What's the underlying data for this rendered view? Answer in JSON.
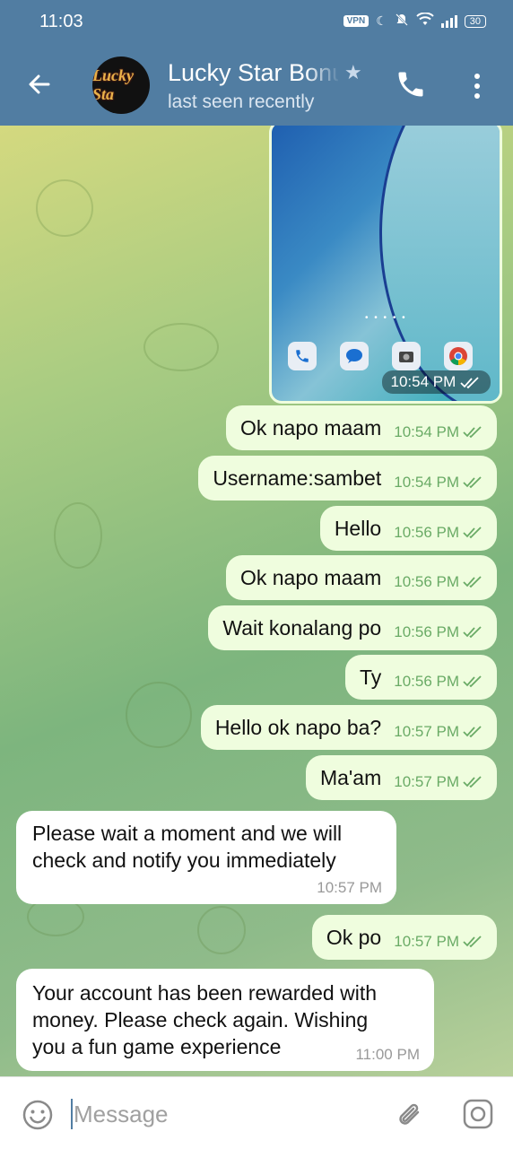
{
  "status_bar": {
    "time": "11:03",
    "vpn_label": "VPN",
    "battery": "30"
  },
  "header": {
    "title": "Lucky Star Bonus",
    "subtitle": "last seen recently",
    "avatar_text": "Lucky Sta"
  },
  "photo": {
    "time": "10:54 PM"
  },
  "messages": [
    {
      "dir": "out",
      "text": "Ok napo maam",
      "time": "10:54 PM"
    },
    {
      "dir": "out",
      "text": "Username:sambet",
      "time": "10:54 PM"
    },
    {
      "dir": "out",
      "text": "Hello",
      "time": "10:56 PM"
    },
    {
      "dir": "out",
      "text": "Ok napo maam",
      "time": "10:56 PM"
    },
    {
      "dir": "out",
      "text": "Wait konalang po",
      "time": "10:56 PM"
    },
    {
      "dir": "out",
      "text": "Ty",
      "time": "10:56 PM"
    },
    {
      "dir": "out",
      "text": "Hello ok napo ba?",
      "time": "10:57 PM"
    },
    {
      "dir": "out",
      "text": "Ma'am",
      "time": "10:57 PM"
    },
    {
      "dir": "in",
      "lines": [
        "Please wait a moment and we will",
        "check and notify you immediately"
      ],
      "time": "10:57 PM"
    },
    {
      "dir": "out",
      "text": "Ok po",
      "time": "10:57 PM"
    },
    {
      "dir": "in",
      "lines": [
        "Your account has been rewarded with",
        "money. Please check again. Wishing",
        "you a fun game experience"
      ],
      "time": "11:00 PM"
    }
  ],
  "composer": {
    "placeholder": "Message"
  },
  "colors": {
    "header": "#517da2",
    "outgoing_bubble": "#effdde",
    "incoming_bubble": "#ffffff",
    "check_color": "#6aab66"
  }
}
